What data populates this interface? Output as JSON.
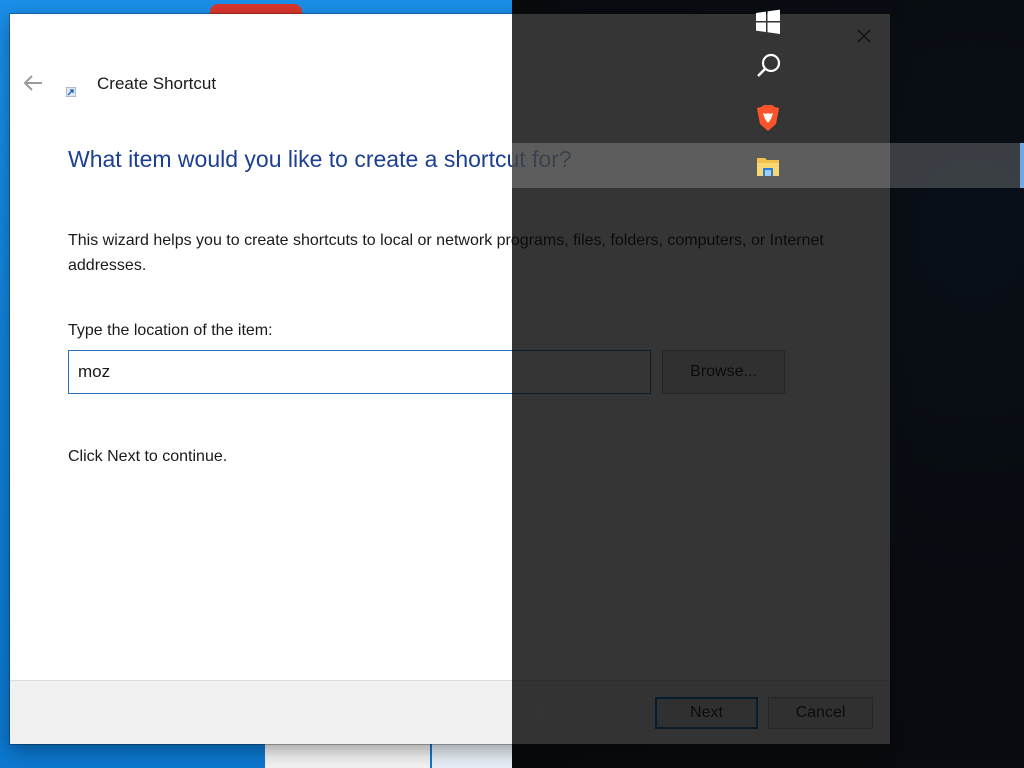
{
  "dialog": {
    "title": "Create Shortcut",
    "heading": "What item would you like to create a shortcut for?",
    "description": "This wizard helps you to create shortcuts to local or network programs, files, folders, computers, or Internet addresses.",
    "location_label": "Type the location of the item:",
    "location_value": "moz",
    "browse_label": "Browse...",
    "continue_text": "Click Next to continue.",
    "next_label": "Next",
    "cancel_label": "Cancel"
  },
  "start_rail": {
    "items": [
      "windows-icon",
      "search-icon",
      "brave-icon",
      "file-explorer-icon"
    ]
  },
  "colors": {
    "heading": "#1c3f94",
    "accent": "#0078d7",
    "overlay": "#141414"
  }
}
